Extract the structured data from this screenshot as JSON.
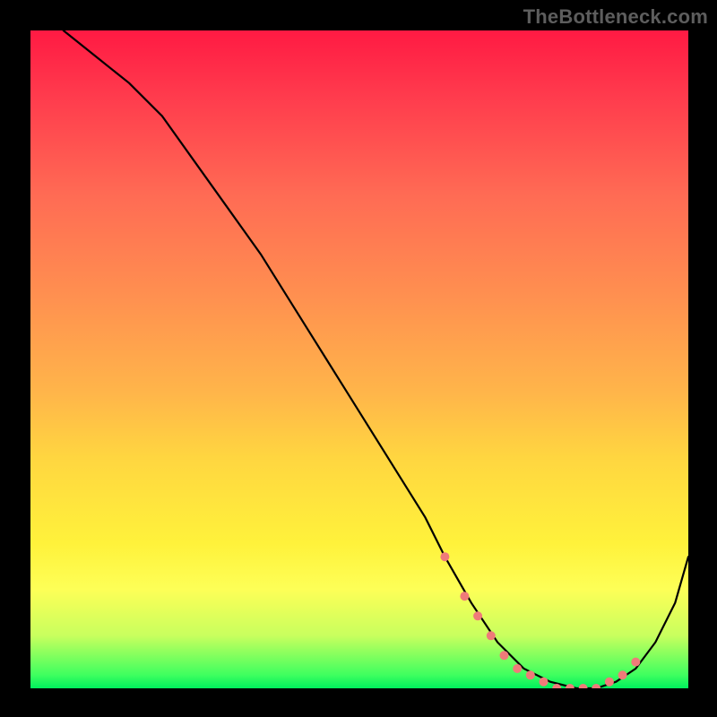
{
  "watermark": "TheBottleneck.com",
  "chart_data": {
    "type": "line",
    "title": "",
    "xlabel": "",
    "ylabel": "",
    "xlim": [
      0,
      100
    ],
    "ylim": [
      0,
      100
    ],
    "series": [
      {
        "name": "bottleneck-curve",
        "x": [
          5,
          10,
          15,
          20,
          25,
          30,
          35,
          40,
          45,
          50,
          55,
          60,
          63,
          67,
          71,
          75,
          79,
          83,
          86,
          89,
          92,
          95,
          98,
          100
        ],
        "y": [
          100,
          96,
          92,
          87,
          80,
          73,
          66,
          58,
          50,
          42,
          34,
          26,
          20,
          13,
          7,
          3,
          1,
          0,
          0,
          1,
          3,
          7,
          13,
          20
        ]
      }
    ],
    "highlights": {
      "name": "curve-highlight-dots",
      "x": [
        63,
        66,
        68,
        70,
        72,
        74,
        76,
        78,
        80,
        82,
        84,
        86,
        88,
        90,
        92
      ],
      "y": [
        20,
        14,
        11,
        8,
        5,
        3,
        2,
        1,
        0,
        0,
        0,
        0,
        1,
        2,
        4
      ]
    }
  }
}
